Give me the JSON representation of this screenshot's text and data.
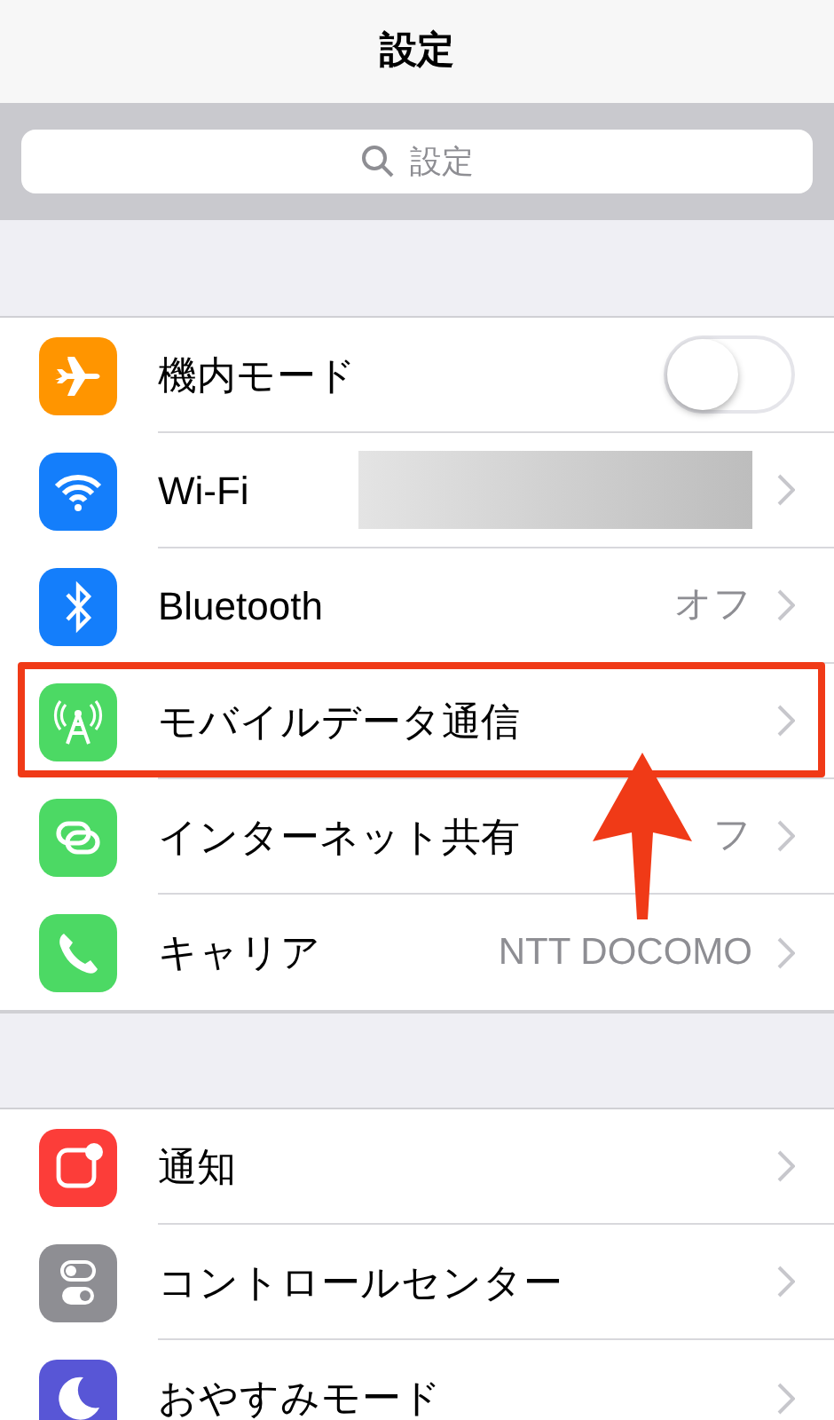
{
  "nav": {
    "title": "設定"
  },
  "search": {
    "placeholder": "設定"
  },
  "groups": [
    {
      "items": [
        {
          "color": "#ff9500",
          "label": "機内モード",
          "kind": "toggle",
          "on": false,
          "highlighted": false
        },
        {
          "color": "#147efb",
          "label": "Wi-Fi",
          "kind": "redacted",
          "highlighted": false
        },
        {
          "color": "#147efb",
          "label": "Bluetooth",
          "kind": "link",
          "value": "オフ",
          "highlighted": false
        },
        {
          "color": "#4cd964",
          "label": "モバイルデータ通信",
          "kind": "link",
          "highlighted": true
        },
        {
          "color": "#4cd964",
          "label": "インターネット共有",
          "kind": "link",
          "value": "フ",
          "highlighted": false
        },
        {
          "color": "#4cd964",
          "label": "キャリア",
          "kind": "link",
          "value": "NTT DOCOMO",
          "highlighted": false
        }
      ]
    },
    {
      "items": [
        {
          "color": "#fc3d39",
          "label": "通知",
          "kind": "link",
          "highlighted": false
        },
        {
          "color": "#8e8e93",
          "label": "コントロールセンター",
          "kind": "link",
          "highlighted": false
        },
        {
          "color": "#5856d6",
          "label": "おやすみモード",
          "kind": "link",
          "highlighted": false
        }
      ]
    }
  ]
}
